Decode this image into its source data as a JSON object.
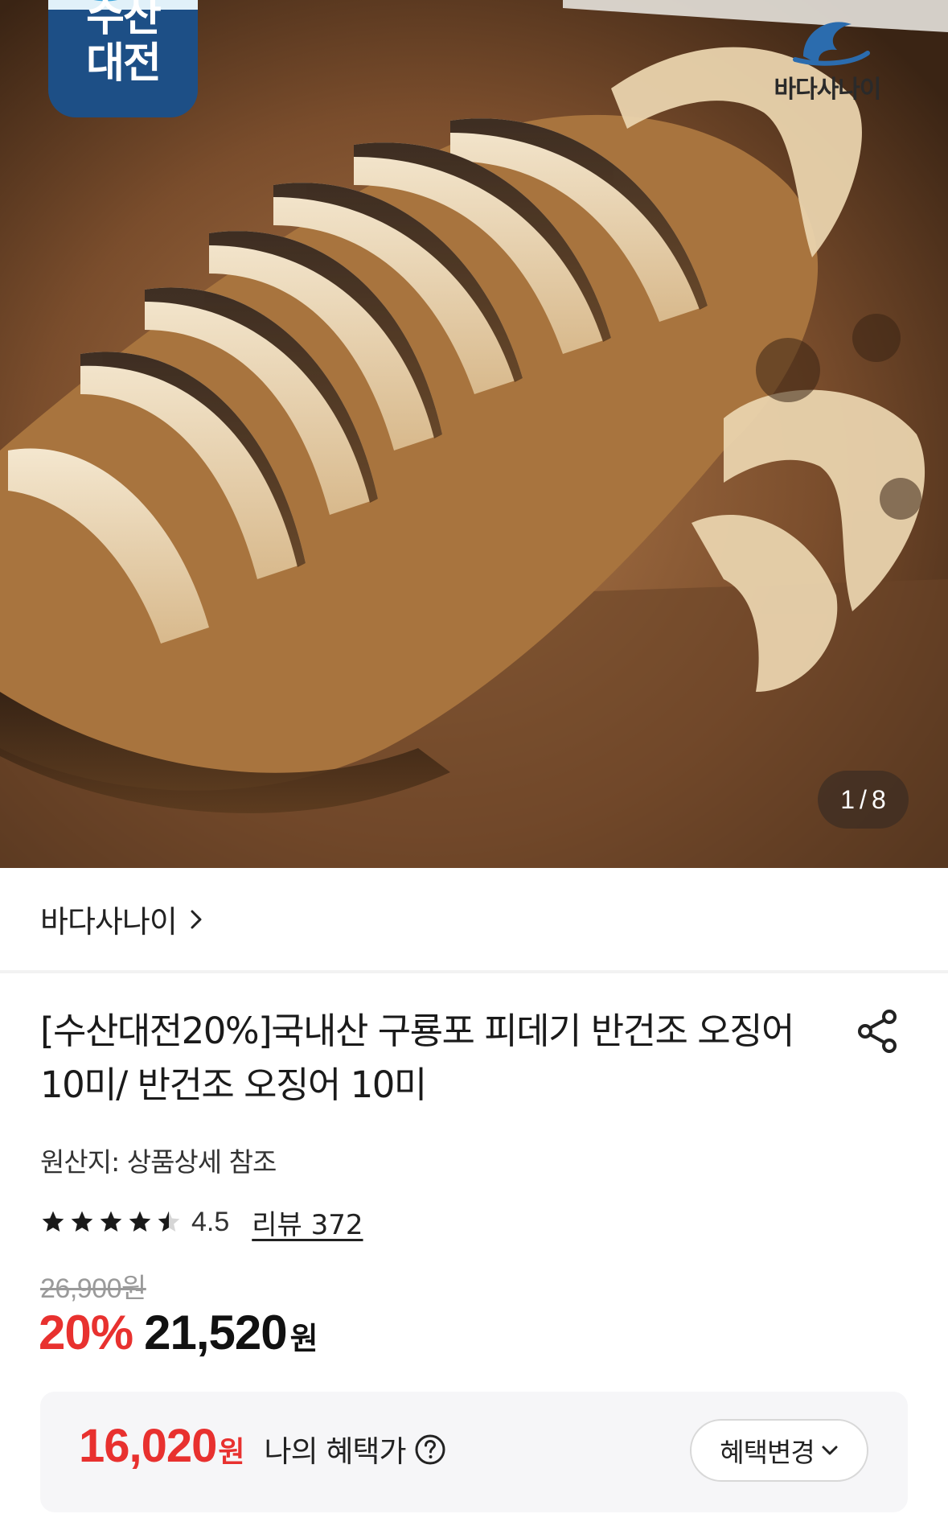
{
  "hero": {
    "badge_line1": "수산",
    "badge_line2": "대전",
    "watermark_text": "바다사나이",
    "counter_current": "1",
    "counter_separator": "/",
    "counter_total": "8"
  },
  "seller": {
    "name": "바다사나이"
  },
  "product": {
    "title": "[수산대전20%]국내산 구룡포 피데기 반건조 오징어 10미/ 반건조 오징어 10미",
    "origin_label": "원산지:",
    "origin_value": "상품상세 참조",
    "rating": 4.5,
    "rating_text": "4.5",
    "review_label": "리뷰 372",
    "original_price": "26,900원",
    "discount_rate": "20%",
    "sale_price": "21,520",
    "sale_unit": "원"
  },
  "benefit": {
    "amount": "16,020",
    "unit": "원",
    "label": "나의 혜택가",
    "change_button": "혜택변경"
  },
  "colors": {
    "accent_red": "#e8312f",
    "badge_blue": "#1d4f86",
    "benefit_bg": "#f6f6f8"
  },
  "icons": {
    "share": "share-icon",
    "help": "question-circle-icon",
    "chevron_right": "chevron-right-icon",
    "chevron_down": "chevron-down-icon",
    "star": "star-icon"
  }
}
